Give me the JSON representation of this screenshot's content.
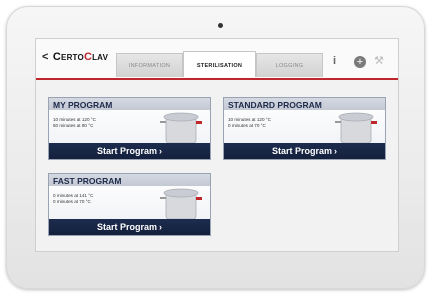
{
  "header": {
    "back_chevron": "<",
    "brand_prefix": "C",
    "brand_mid": "ERTO",
    "brand_c": "C",
    "brand_suffix": "LAV"
  },
  "tabs": [
    {
      "label": "INFORMATION"
    },
    {
      "label": "STERILISATION"
    },
    {
      "label": "LOGGING"
    }
  ],
  "toolbar": {
    "info_icon": "info-icon",
    "add_icon": "plus-circle-icon",
    "settings_icon": "wrench-icon",
    "info_glyph": "i",
    "add_glyph": "+",
    "wrench_glyph": "⚒"
  },
  "programs": [
    {
      "title": "MY PROGRAM",
      "line1": "10 minutes at 120 °C",
      "line2": "60 minutes at 80 °C",
      "start_label": "Start Program",
      "arrow": "›"
    },
    {
      "title": "STANDARD PROGRAM",
      "line1": "10 minutes at 120 °C",
      "line2": "0 minutes at 70 °C",
      "start_label": "Start Program",
      "arrow": "›"
    },
    {
      "title": "FAST PROGRAM",
      "line1": "0 minutes at 141 °C",
      "line2": "0 minutes at 70 °C",
      "start_label": "Start Program",
      "arrow": "›"
    }
  ],
  "colors": {
    "accent": "#c0272d",
    "button": "#1d2c4f"
  }
}
